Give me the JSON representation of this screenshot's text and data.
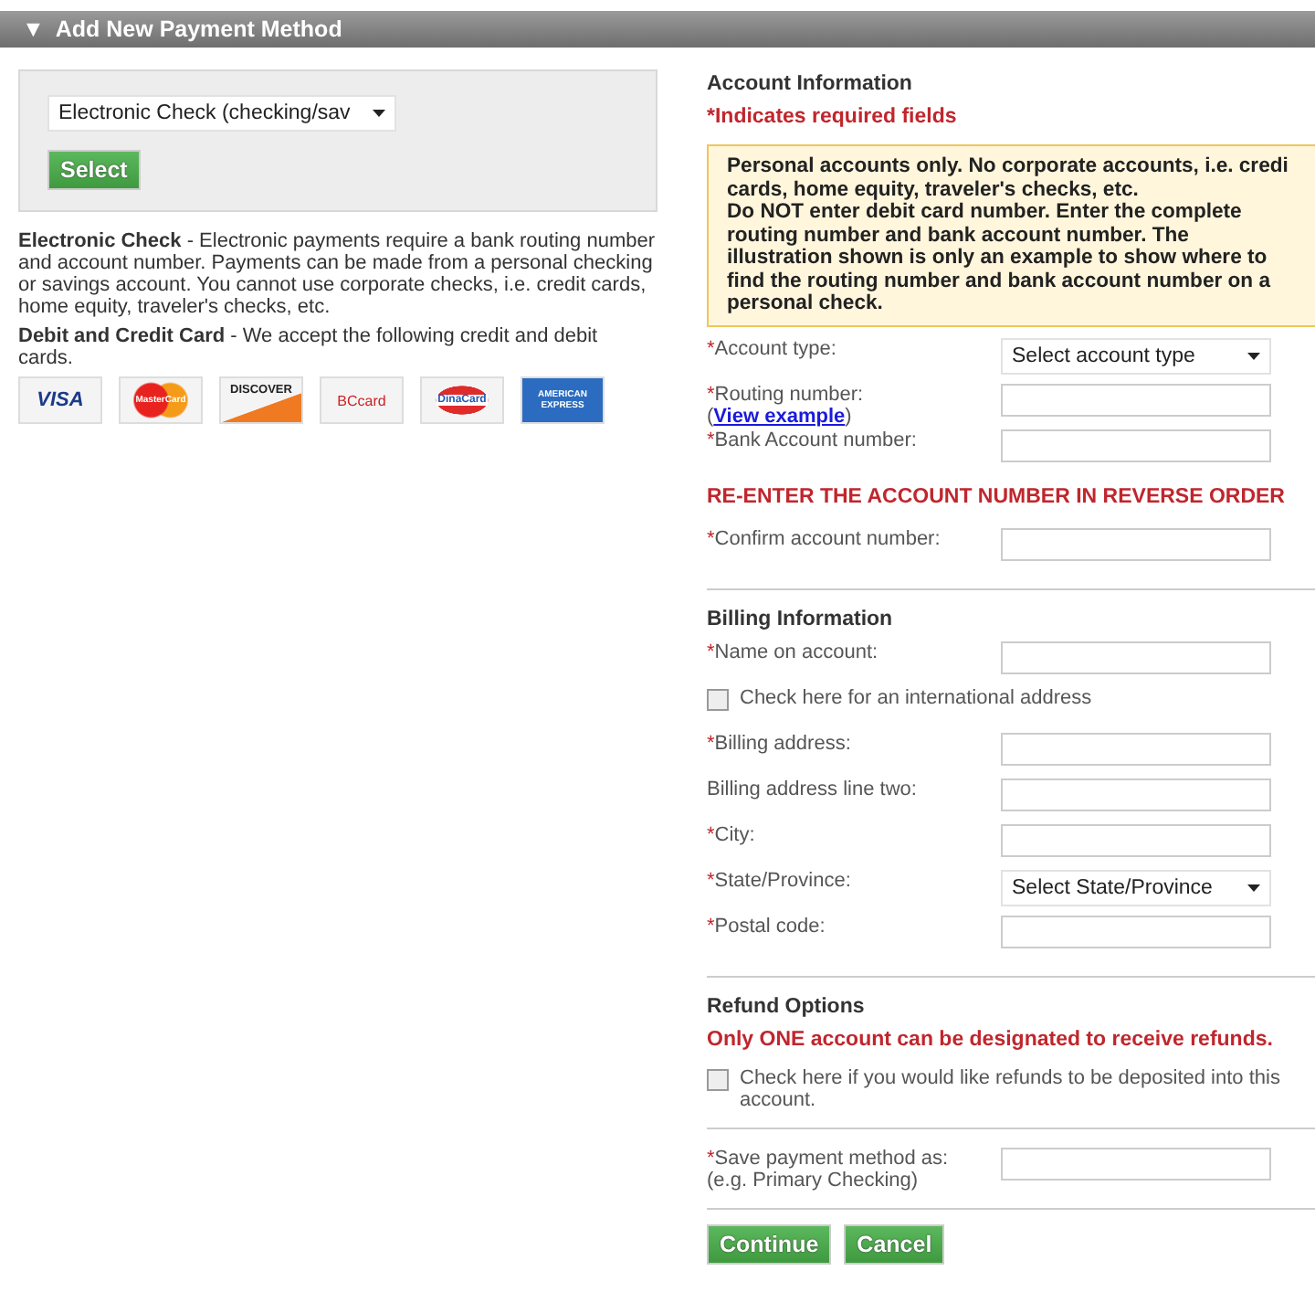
{
  "header": {
    "arrow": "▼",
    "title": "Add New Payment Method"
  },
  "method_picker": {
    "value": "Electronic Check (checking/sav",
    "button": "Select"
  },
  "descriptions": [
    {
      "title": "Electronic Check",
      "text": " - Electronic payments require a bank routing number and account number. Payments can be made from a personal checking or savings account. You cannot use corporate checks, i.e. credit cards, home equity, traveler's checks, etc."
    },
    {
      "title": "Debit and Credit Card",
      "text": " - We accept the following credit and debit cards."
    }
  ],
  "cards": [
    {
      "kind": "visa",
      "label": "VISA"
    },
    {
      "kind": "mastercard",
      "label": "MasterCard"
    },
    {
      "kind": "discover",
      "label": "DISCOVER"
    },
    {
      "kind": "bccard",
      "label": "BCcard"
    },
    {
      "kind": "dinacard",
      "label": "DinaCard"
    },
    {
      "kind": "amex",
      "label": "AMERICAN EXPRESS"
    }
  ],
  "sections": [
    {
      "heading": "Account Information",
      "rows": [
        {
          "kind": "alert",
          "text": "*Indicates required fields"
        },
        {
          "kind": "notice",
          "lines": [
            "Personal accounts only. No corporate accounts, i.e. credi",
            "cards, home equity, traveler's checks, etc.",
            "Do NOT enter debit card number. Enter the complete",
            "routing number and bank account number. The",
            "illustration shown is only an example to show where to",
            "find the routing number and bank account number on a",
            "personal check."
          ]
        },
        {
          "kind": "select",
          "mark": "*",
          "label": "Account type:",
          "value": "Select account type"
        },
        {
          "kind": "field",
          "mark": "*",
          "label": "Routing number:",
          "link_open": "(",
          "link": "View example",
          "link_close": ")"
        },
        {
          "kind": "field",
          "mark": "*",
          "label": "Bank Account number:"
        },
        {
          "kind": "caps_alert",
          "text": "RE-ENTER THE ACCOUNT NUMBER IN REVERSE ORDER"
        },
        {
          "kind": "field",
          "mark": "*",
          "label": "Confirm account number:"
        }
      ]
    },
    {
      "heading": "Billing Information",
      "rows": [
        {
          "kind": "field",
          "mark": "*",
          "label": "Name on account:"
        },
        {
          "kind": "checkbox",
          "label": "Check here for an international address",
          "checked": false
        },
        {
          "kind": "field",
          "mark": "*",
          "label": "Billing address:"
        },
        {
          "kind": "field",
          "label": "Billing address line two:"
        },
        {
          "kind": "field",
          "mark": "*",
          "label": "City:"
        },
        {
          "kind": "select",
          "mark": "*",
          "label": "State/Province:",
          "value": "Select State/Province"
        },
        {
          "kind": "field",
          "mark": "*",
          "label": "Postal code:"
        }
      ]
    },
    {
      "heading": "Refund Options",
      "rows": [
        {
          "kind": "alert",
          "text": "Only ONE account can be designated to receive refunds."
        },
        {
          "kind": "checkbox",
          "label": "Check here if you would like refunds to be deposited into this account.",
          "checked": false
        }
      ]
    },
    {
      "rows": [
        {
          "kind": "field",
          "mark": "*",
          "label": "Save payment method as:",
          "hint": "(e.g. Primary Checking)"
        }
      ]
    }
  ],
  "buttons": [
    "Continue",
    "Cancel"
  ]
}
